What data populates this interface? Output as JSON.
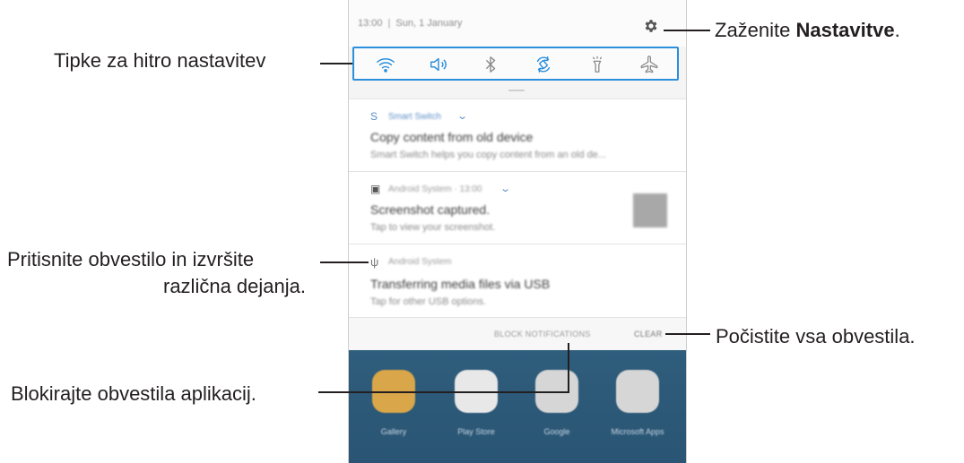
{
  "phone": {
    "status": {
      "time": "13:00",
      "date": "Sun, 1 January"
    },
    "quick_settings": [
      "wifi-icon",
      "sound-icon",
      "bluetooth-icon",
      "auto-rotate-icon",
      "flashlight-icon",
      "airplane-mode-icon"
    ],
    "notifications": [
      {
        "app": "Smart Switch",
        "title": "Copy content from old device",
        "text": "Smart Switch helps you copy content from an old de..."
      },
      {
        "app": "Android System · 13:00",
        "title": "Screenshot captured.",
        "text": "Tap to view your screenshot."
      },
      {
        "app": "Android System",
        "title": "Transferring media files via USB",
        "text": "Tap for other USB options."
      }
    ],
    "actions": {
      "block": "BLOCK NOTIFICATIONS",
      "clear": "CLEAR"
    },
    "home_apps": [
      {
        "label": "Gallery"
      },
      {
        "label": "Play Store"
      },
      {
        "label": "Google"
      },
      {
        "label": "Microsoft Apps"
      }
    ]
  },
  "callouts": {
    "launch_settings_prefix": "Zaženite ",
    "launch_settings_bold": "Nastavitve",
    "launch_settings_suffix": ".",
    "quick_settings": "Tipke za hitro nastavitev",
    "tap_notification_line1": "Pritisnite obvestilo in izvršite",
    "tap_notification_line2": "različna dejanja.",
    "clear_all": "Počistite vsa obvestila.",
    "block_app": "Blokirajte obvestila aplikacij."
  },
  "colors": {
    "accent": "#2b8fdc",
    "home_bg": "#2f5d7c"
  }
}
